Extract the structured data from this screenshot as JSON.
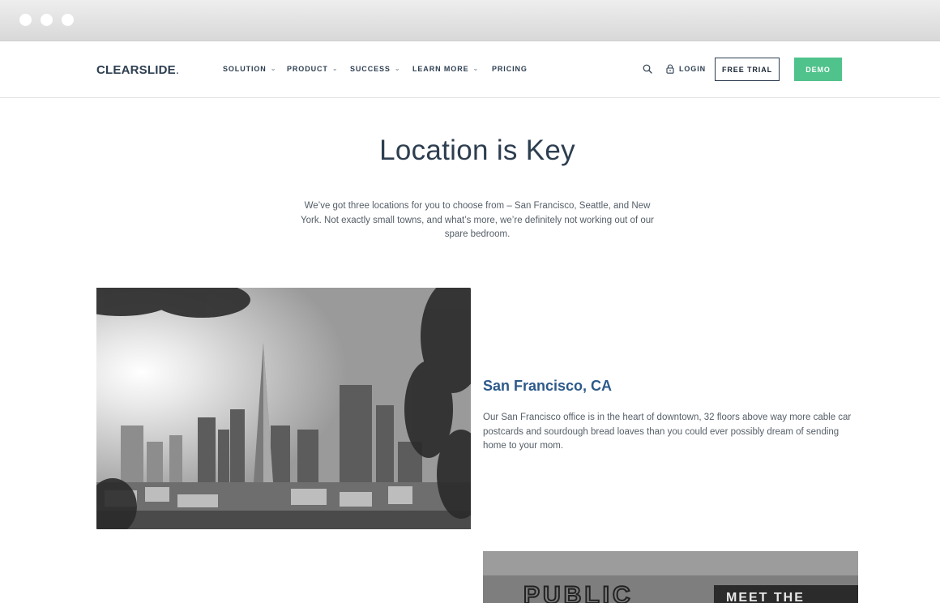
{
  "nav": {
    "logo_bold": "CLEARSLIDE",
    "logo_light": ".",
    "items": [
      {
        "label": "SOLUTION",
        "has_caret": true
      },
      {
        "label": "PRODUCT",
        "has_caret": true
      },
      {
        "label": "SUCCESS",
        "has_caret": true
      },
      {
        "label": "LEARN MORE",
        "has_caret": true
      },
      {
        "label": "PRICING",
        "has_caret": false
      }
    ],
    "caret": "⌄",
    "login": "LOGIN",
    "free_trial": "FREE TRIAL",
    "demo": "DEMO"
  },
  "main": {
    "heading": "Location is Key",
    "intro": "We’ve got three locations for you to choose from – San Francisco, Seattle, and New York. Not exactly small towns, and what’s more, we’re definitely not working out of our spare bedroom.",
    "locations": [
      {
        "title": "San Francisco, CA",
        "description": "Our San Francisco office is in the heart of downtown, 32 floors above way more cable car postcards and sourdough bread loaves than you could ever possibly dream of sending home to your mom."
      }
    ],
    "market_sign_left": "PUBLIC",
    "market_sign_right": "MEET THE"
  },
  "colors": {
    "navy": "#2d3e50",
    "demo_green": "#50c28b",
    "link_blue": "#2d5a8a",
    "body_text": "#555e67"
  },
  "icons": [
    "search-icon",
    "lock-icon",
    "chevron-down-icon"
  ]
}
